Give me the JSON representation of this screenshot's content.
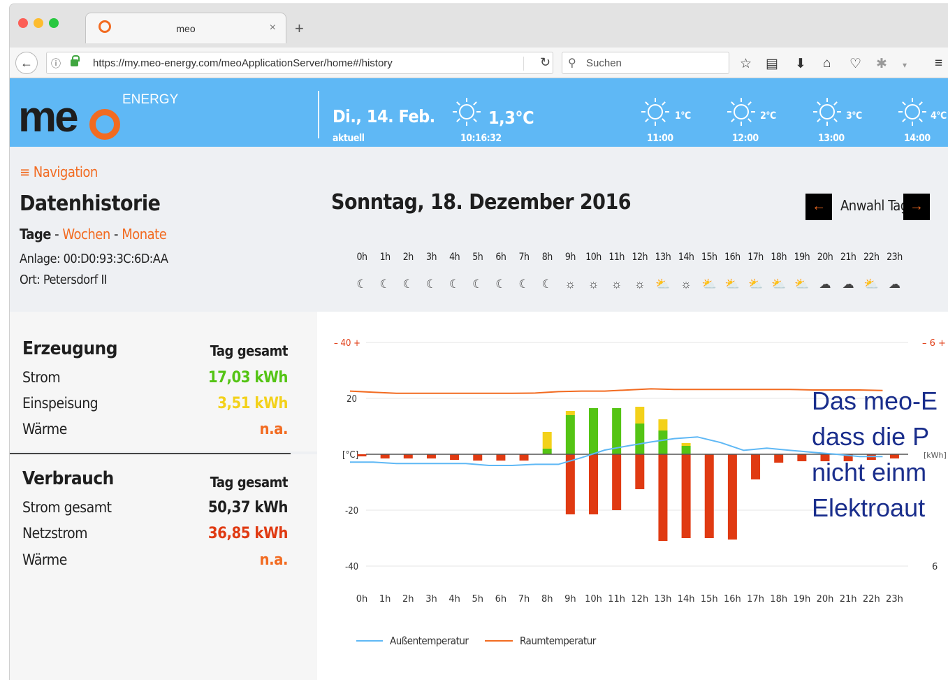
{
  "browser": {
    "tab_title": "meo",
    "tab_close": "×",
    "new_tab": "+",
    "url": "https://my.meo-energy.com/meoApplicationServer/home#/history",
    "search_placeholder": "Suchen",
    "icons": [
      "back-icon",
      "info-icon",
      "lock-icon",
      "reload-icon",
      "search-icon",
      "bookmark-star-icon",
      "reading-list-icon",
      "download-icon",
      "home-icon",
      "pocket-icon",
      "extension-icon",
      "menu-icon"
    ]
  },
  "header": {
    "logo_text": "me",
    "logo_energy": "ENERGY",
    "date": "Di., 14. Feb.",
    "date_sub": "aktuell",
    "current_temp": "1,3°C",
    "current_time": "10:16:32",
    "forecast": [
      {
        "temp": "1°C",
        "time": "11:00"
      },
      {
        "temp": "2°C",
        "time": "12:00"
      },
      {
        "temp": "3°C",
        "time": "13:00"
      },
      {
        "temp": "4°C",
        "time": "14:00"
      }
    ]
  },
  "sidebar": {
    "nav_label": "Navigation",
    "title": "Datenhistorie",
    "period_active": "Tage",
    "period_sep": " - ",
    "period_weeks": "Wochen",
    "period_months": "Monate",
    "anlage": "Anlage: 00:D0:93:3C:6D:AA",
    "ort": "Ort: Petersdorf II"
  },
  "erzeugung": {
    "title": "Erzeugung",
    "col": "Tag gesamt",
    "rows": [
      {
        "label": "Strom",
        "value": "17,03 kWh",
        "color": "#54c414"
      },
      {
        "label": "Einspeisung",
        "value": "3,51 kWh",
        "color": "#f3d11a"
      },
      {
        "label": "Wärme",
        "value": "n.a.",
        "color": "#f26b21"
      }
    ]
  },
  "verbrauch": {
    "title": "Verbrauch",
    "col": "Tag gesamt",
    "rows": [
      {
        "label": "Strom gesamt",
        "value": "50,37 kWh",
        "color": "#1e1e1e"
      },
      {
        "label": "Netzstrom",
        "value": "36,85 kWh",
        "color": "#e03a12"
      },
      {
        "label": "Wärme",
        "value": "n.a.",
        "color": "#f26b21"
      }
    ]
  },
  "main": {
    "date_title": "Sonntag, 18. Dezember 2016",
    "day_select_label": "Anwahl Tag",
    "prev_arrow": "←",
    "next_arrow": "→",
    "hours": [
      "0h",
      "1h",
      "2h",
      "3h",
      "4h",
      "5h",
      "6h",
      "7h",
      "8h",
      "9h",
      "10h",
      "11h",
      "12h",
      "13h",
      "14h",
      "15h",
      "16h",
      "17h",
      "18h",
      "19h",
      "20h",
      "21h",
      "22h",
      "23h"
    ],
    "weather_icons": [
      "moon",
      "moon",
      "moon",
      "moon",
      "moon",
      "moon",
      "moon",
      "moon",
      "moon",
      "sun",
      "sun",
      "sun",
      "sun",
      "sun-cloud",
      "sun",
      "sun-cloud",
      "sun-cloud",
      "sun-cloud",
      "sun-cloud",
      "sun-cloud",
      "cloud",
      "cloud",
      "sun-cloud",
      "cloud",
      "cloud"
    ],
    "overlay_lines": [
      "Das meo-E",
      "dass die P",
      "nicht einm",
      "Elektroaut"
    ]
  },
  "chart_data": {
    "type": "bar",
    "x": [
      "0h",
      "1h",
      "2h",
      "3h",
      "4h",
      "5h",
      "6h",
      "7h",
      "8h",
      "9h",
      "10h",
      "11h",
      "12h",
      "13h",
      "14h",
      "15h",
      "16h",
      "17h",
      "18h",
      "19h",
      "20h",
      "21h",
      "22h",
      "23h"
    ],
    "left_axis": {
      "label": "[°C]",
      "ticks": [
        "– 40 +",
        "20",
        "-20",
        "-40"
      ],
      "ylim": [
        -40,
        40
      ]
    },
    "right_axis": {
      "label": "[kWh]",
      "ticks": [
        "– 6 +",
        "6"
      ]
    },
    "series": [
      {
        "name": "Strom",
        "color": "#54c414",
        "values": [
          0,
          0,
          0,
          0,
          0,
          0,
          0,
          0,
          0.4,
          2.8,
          3.3,
          3.3,
          2.2,
          1.7,
          0.6,
          0,
          0,
          0,
          0,
          0,
          0,
          0,
          0,
          0
        ]
      },
      {
        "name": "Einspeisung",
        "color": "#f3d11a",
        "values": [
          0,
          0,
          0,
          0,
          0,
          0,
          0,
          0,
          1.2,
          0.3,
          0,
          0,
          1.2,
          0.8,
          0.2,
          0,
          0,
          0,
          0,
          0,
          0,
          0,
          0,
          0
        ]
      },
      {
        "name": "Netzstrom",
        "color": "#e03a12",
        "values": [
          -0.15,
          -0.3,
          -0.3,
          -0.3,
          -0.4,
          -0.45,
          -0.45,
          -0.45,
          0,
          -4.3,
          -4.3,
          -4.0,
          -2.5,
          -6.2,
          -6.0,
          -6.0,
          -6.1,
          -1.8,
          -0.6,
          -0.5,
          -0.5,
          -0.5,
          -0.4,
          -0.3
        ]
      },
      {
        "name": "Außentemperatur",
        "color": "#5fb8f5",
        "values": [
          -2.8,
          -2.8,
          -3.3,
          -3.3,
          -3.3,
          -3.3,
          -4.0,
          -4.0,
          -3.6,
          -3.6,
          -1.2,
          1.5,
          3.0,
          4.4,
          5.6,
          6.2,
          4.2,
          1.4,
          2.2,
          1.4,
          0.7,
          0.0,
          -0.8,
          -0.8
        ]
      },
      {
        "name": "Raumtemperatur",
        "color": "#f26b21",
        "values": [
          22.6,
          22.2,
          21.8,
          21.8,
          21.8,
          21.8,
          21.8,
          21.8,
          21.9,
          22.4,
          22.6,
          22.6,
          23.0,
          23.4,
          23.2,
          23.2,
          23.2,
          23.2,
          23.2,
          23.2,
          23.0,
          23.0,
          23.0,
          22.8
        ]
      }
    ],
    "legend": [
      "Außentemperatur",
      "Raumtemperatur"
    ],
    "x_tick_labels": [
      "0h",
      "1h",
      "2h",
      "3h",
      "4h",
      "5h",
      "6h",
      "7h",
      "8h",
      "9h",
      "10h",
      "11h",
      "12h",
      "13h",
      "14h",
      "15h",
      "16h",
      "17h",
      "18h",
      "19h",
      "20h",
      "21h",
      "22h",
      "23h"
    ],
    "grid": true,
    "legend_placement": "bottom-left"
  }
}
